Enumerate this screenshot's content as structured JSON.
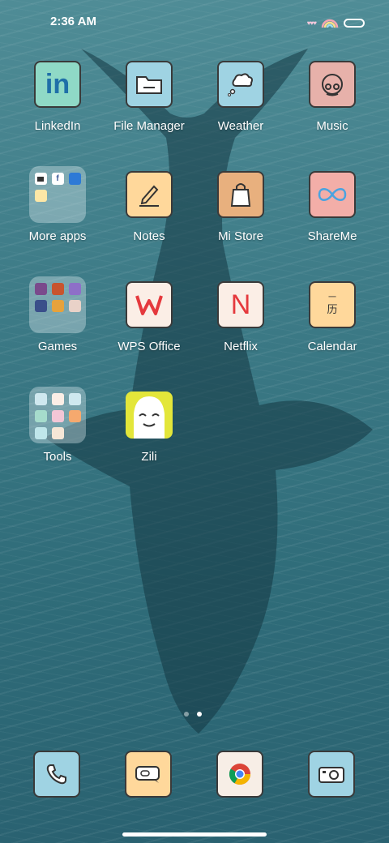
{
  "status": {
    "time": "2:36 AM"
  },
  "apps": [
    {
      "label": "LinkedIn",
      "icon": "linkedin-icon",
      "color": "#8fd9c6"
    },
    {
      "label": "File Manager",
      "icon": "folder-icon",
      "color": "#9fd3e3"
    },
    {
      "label": "Weather",
      "icon": "weather-icon",
      "color": "#9fd3e3"
    },
    {
      "label": "Music",
      "icon": "headphones-icon",
      "color": "#e7b1aa"
    },
    {
      "label": "More apps",
      "icon": "folder-icon"
    },
    {
      "label": "Notes",
      "icon": "pen-icon",
      "color": "#ffd89b"
    },
    {
      "label": "Mi Store",
      "icon": "shopping-bag-icon",
      "color": "#e8b07e"
    },
    {
      "label": "ShareMe",
      "icon": "infinity-icon",
      "color": "#f3aea8"
    },
    {
      "label": "Games",
      "icon": "folder-icon"
    },
    {
      "label": "WPS Office",
      "icon": "wps-icon",
      "color": "#fbeee6"
    },
    {
      "label": "Netflix",
      "icon": "netflix-icon",
      "color": "#fbeee6"
    },
    {
      "label": "Calendar",
      "icon": "calendar-icon",
      "color": "#ffd89b"
    },
    {
      "label": "Tools",
      "icon": "folder-icon"
    },
    {
      "label": "Zili",
      "icon": "zili-icon",
      "color": "#e3e63a"
    }
  ],
  "icon_text": {
    "linkedin": "in",
    "netflix": "N",
    "calendar_top": "一",
    "calendar_main": "历",
    "more_f": "f"
  },
  "dock": [
    {
      "icon": "phone-icon",
      "color": "#9fd3e3"
    },
    {
      "icon": "messages-icon",
      "color": "#ffd89b"
    },
    {
      "icon": "chrome-icon",
      "color": "#f7eee6"
    },
    {
      "icon": "camera-icon",
      "color": "#9fd3e3"
    }
  ],
  "pages": {
    "count": 2,
    "active": 2
  }
}
